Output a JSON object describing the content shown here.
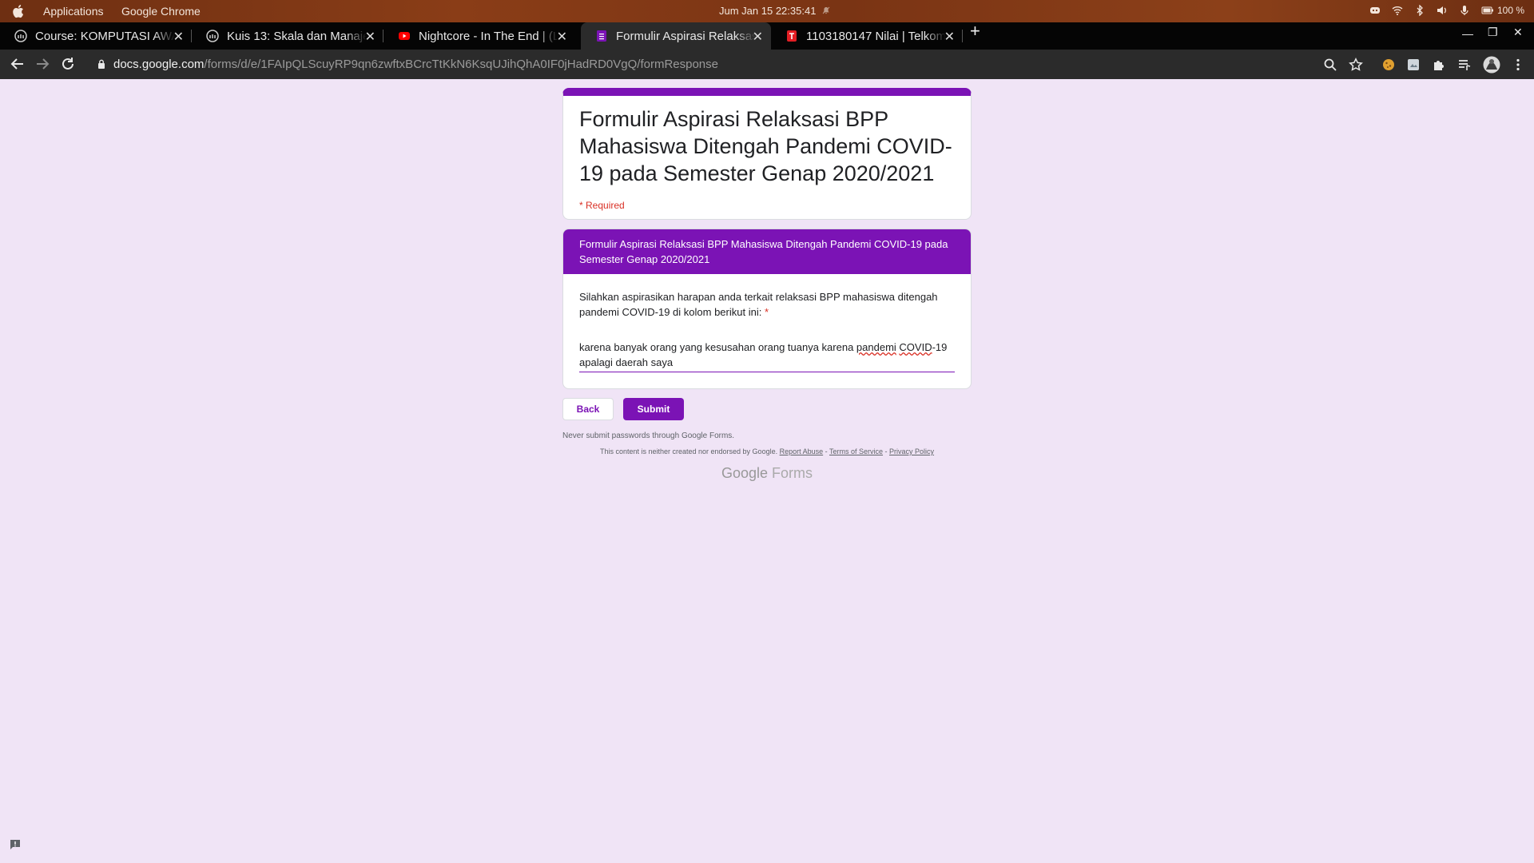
{
  "system_bar": {
    "menus": [
      "Applications",
      "Google Chrome"
    ],
    "clock": "Jum Jan 15  22:35:41",
    "battery": "100 %"
  },
  "tabs": [
    {
      "title": "Course: KOMPUTASI AWAN",
      "favicon": "moodle-icon",
      "active": false
    },
    {
      "title": "Kuis 13: Skala dan Manajemen",
      "favicon": "moodle-icon",
      "active": false
    },
    {
      "title": "Nightcore - In The End | (Lyrics)",
      "favicon": "youtube-icon",
      "active": false
    },
    {
      "title": "Formulir Aspirasi Relaksasi BPP",
      "favicon": "google-forms-icon",
      "active": true
    },
    {
      "title": "1103180147 Nilai | Telkom",
      "favicon": "telkom-icon",
      "active": false
    }
  ],
  "address_bar": {
    "host": "docs.google.com",
    "path": "/forms/d/e/1FAIpQLScuyRP9qn6zwftxBCrcTtKkN6KsqUJihQhA0IF0jHadRD0VgQ/formResponse"
  },
  "form": {
    "title": "Formulir Aspirasi Relaksasi BPP Mahasiswa Ditengah Pandemi COVID-19 pada Semester Genap 2020/2021",
    "required_note": "* Required",
    "section_title": "Formulir Aspirasi Relaksasi BPP Mahasiswa Ditengah Pandemi COVID-19 pada Semester Genap 2020/2021",
    "question": "Silahkan aspirasikan harapan anda terkait relaksasi BPP mahasiswa ditengah pandemi COVID-19 di kolom berikut ini:",
    "question_required_mark": "*",
    "answer_part1": "karena banyak orang yang kesusahan orang tuanya karena ",
    "answer_word1": "pandemi",
    "answer_space": " ",
    "answer_word2": "COVID",
    "answer_part2": "-19 apalagi daerah saya",
    "back_label": "Back",
    "submit_label": "Submit",
    "password_warning": "Never submit passwords through Google Forms.",
    "disclaimer": "This content is neither created nor endorsed by Google.",
    "report_abuse": "Report Abuse",
    "dash": " - ",
    "terms": "Terms of Service",
    "privacy": "Privacy Policy",
    "logo_google": "Google",
    "logo_forms": "Forms"
  },
  "colors": {
    "accent": "#7b13b5",
    "page_bg": "#f0e4f6",
    "required": "#d93025"
  }
}
